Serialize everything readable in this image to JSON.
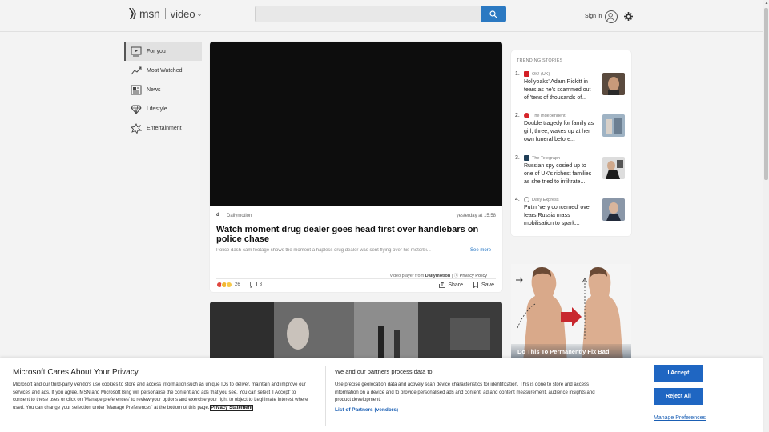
{
  "header": {
    "brand": "msn",
    "section": "video",
    "signin_label": "Sign in"
  },
  "colors": {
    "accent": "#2b79c2",
    "banner_button": "#1f66c2"
  },
  "sidebar": {
    "items": [
      {
        "label": "For you",
        "icon": "play-screen-icon"
      },
      {
        "label": "Most Watched",
        "icon": "trending-line-icon"
      },
      {
        "label": "News",
        "icon": "newspaper-icon"
      },
      {
        "label": "Lifestyle",
        "icon": "diamond-icon"
      },
      {
        "label": "Entertainment",
        "icon": "star-burst-icon"
      }
    ]
  },
  "video": {
    "source": "Dailymotion",
    "time": "yesterday at 15:58",
    "title": "Watch moment drug dealer goes head first over handlebars on police chase",
    "description": "Police dash-cam footage shows the moment a hapless drug dealer was sent flying over his motorbi...",
    "see_more": "See more",
    "player_from_prefix": "video player from",
    "player_from_source": "Dailymotion",
    "privacy_policy": "Privacy Policy",
    "reactions_count": "26",
    "comments_count": "3",
    "share_label": "Share",
    "save_label": "Save"
  },
  "trending": {
    "heading": "TRENDING STORIES",
    "items": [
      {
        "num": "1.",
        "source": "OK! (UK)",
        "headline": "Hollyoaks' Adam Rickitt in tears as he's scammed out of 'tens of thousands of..."
      },
      {
        "num": "2.",
        "source": "The Independent",
        "headline": "Double tragedy for family as girl, three, wakes up at her own funeral before..."
      },
      {
        "num": "3.",
        "source": "The Telegraph",
        "headline": "Russian spy cosied up to one of UK's richest families as she tried to infiltrate..."
      },
      {
        "num": "4.",
        "source": "Daily Express",
        "headline": "Putin 'very concerned' over fears Russia mass mobilisation to spark..."
      }
    ]
  },
  "ad": {
    "caption": "Do This To Permanently Fix Bad"
  },
  "cookie": {
    "title": "Microsoft Cares About Your Privacy",
    "body": "Microsoft and our third-party vendors use cookies to store and access information such as unique IDs to deliver, maintain and improve our services and ads. If you agree, MSN and Microsoft Bing will personalise the content and ads that you see. You can select 'I Accept' to consent to these uses or click on 'Manage preferences' to review your options and exercise your right to object to Legitimate Interest where used.  You can change your selection under 'Manage Preferences' at the bottom of this page.",
    "privacy_link": "Privacy Statement",
    "subheading": "We and our partners process data to:",
    "body2": "Use precise geolocation data and actively scan device characteristics for identification. This is done to store and access information on a device and to provide personalised ads and content, ad and content measurement, audience insights and product development.",
    "partners_link": "List of Partners (vendors)",
    "accept_label": "I Accept",
    "reject_label": "Reject All",
    "manage_label": "Manage Preferences"
  }
}
